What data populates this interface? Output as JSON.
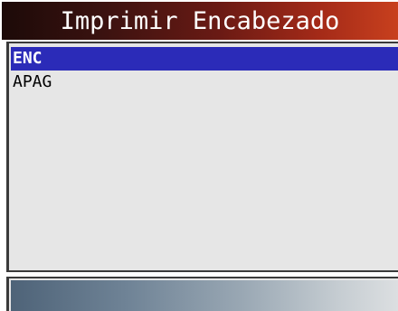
{
  "header": {
    "title": "Imprimir Encabezado"
  },
  "menu": {
    "items": [
      {
        "label": "ENC",
        "selected": true
      },
      {
        "label": "APAG",
        "selected": false
      }
    ]
  },
  "colors": {
    "selection": "#2b2bb8",
    "list_background": "#e6e6e6",
    "title_gradient_start": "#1c0a08",
    "title_gradient_end": "#c8401e",
    "footer_gradient_start": "#4e6378",
    "footer_gradient_end": "#dcdfe1"
  }
}
